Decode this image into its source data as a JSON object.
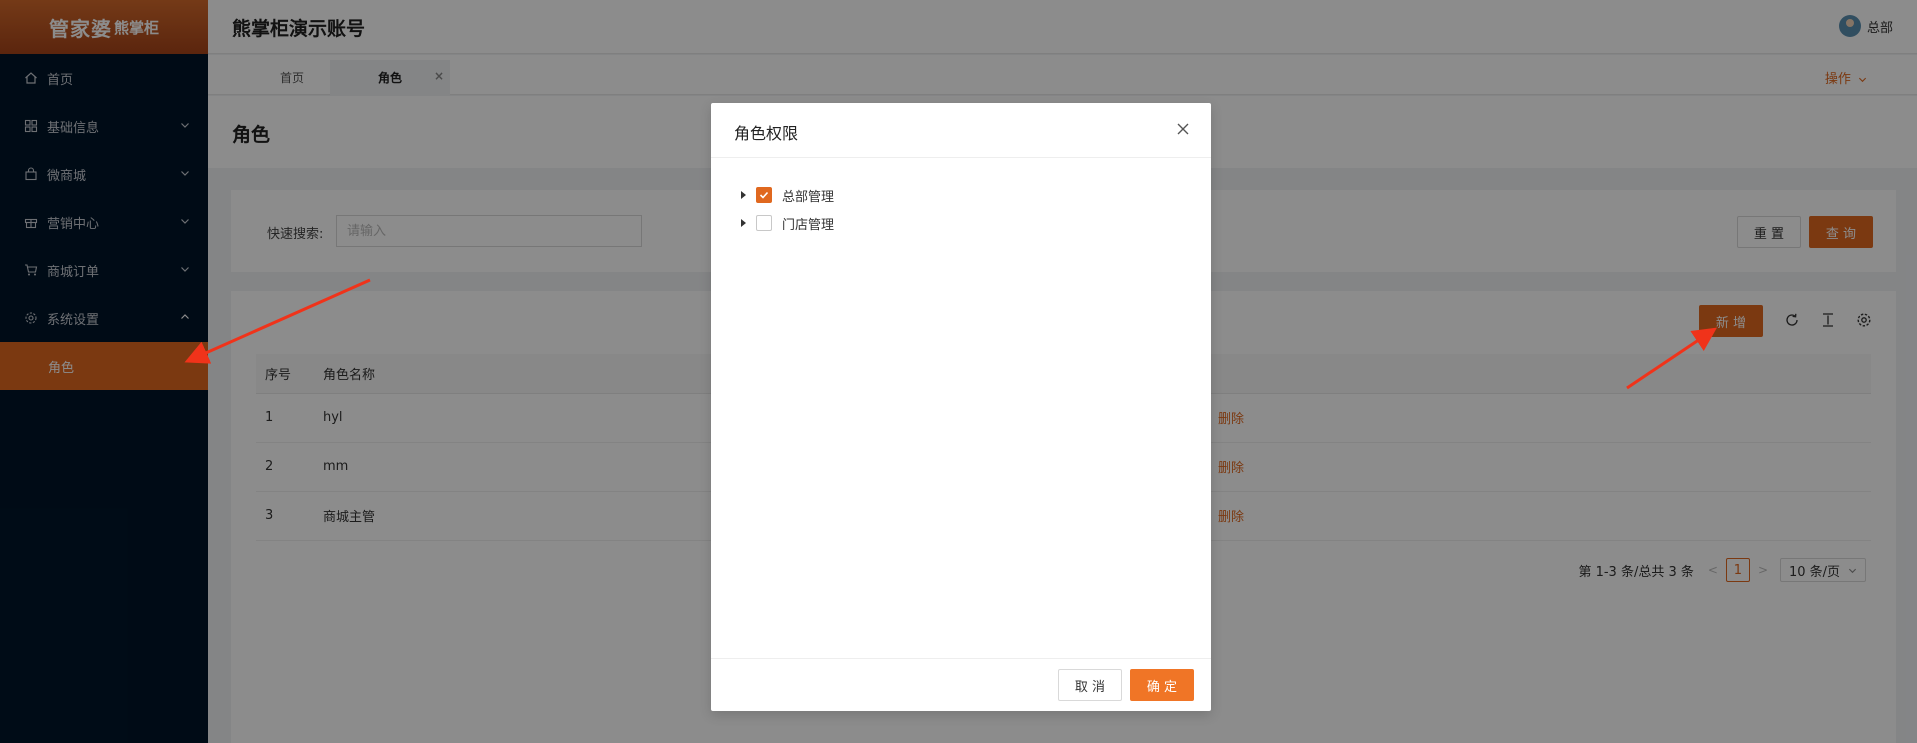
{
  "app": {
    "logo_main": "管家婆",
    "logo_sub": "熊掌柜",
    "account_title": "熊掌柜演示账号",
    "user_name": "总部"
  },
  "sidebar": {
    "items": [
      {
        "label": "首页",
        "icon": "home-icon"
      },
      {
        "label": "基础信息",
        "icon": "grid-icon"
      },
      {
        "label": "微商城",
        "icon": "bag-icon"
      },
      {
        "label": "营销中心",
        "icon": "gift-icon"
      },
      {
        "label": "商城订单",
        "icon": "cart-icon"
      },
      {
        "label": "系统设置",
        "icon": "gear-icon"
      }
    ],
    "sub_active": "角色"
  },
  "tabs": {
    "items": [
      {
        "label": "首页",
        "close": "×"
      },
      {
        "label": "角色",
        "close": "×"
      }
    ],
    "ops_label": "操作"
  },
  "page": {
    "title": "角色"
  },
  "search": {
    "label": "快速搜索:",
    "placeholder": "请输入",
    "reset_label": "重 置",
    "query_label": "查 询"
  },
  "table": {
    "add_label": "新 增",
    "headers": [
      "序号",
      "角色名称"
    ],
    "rows": [
      {
        "index": "1",
        "name": "hyl",
        "action": "删除"
      },
      {
        "index": "2",
        "name": "mm",
        "action": "删除"
      },
      {
        "index": "3",
        "name": "商城主管",
        "action": "删除"
      }
    ]
  },
  "pagination": {
    "summary": "第 1-3 条/总共 3 条",
    "current_page": "1",
    "prev": "<",
    "next": ">",
    "page_size": "10 条/页"
  },
  "modal": {
    "title": "角色权限",
    "tree": [
      {
        "label": "总部管理",
        "checked": true
      },
      {
        "label": "门店管理",
        "checked": false
      }
    ],
    "cancel_label": "取 消",
    "ok_label": "确 定"
  },
  "colors": {
    "accent": "#e0681f",
    "sidebar_bg": "#001529",
    "annotation_arrow": "#f0331a"
  }
}
